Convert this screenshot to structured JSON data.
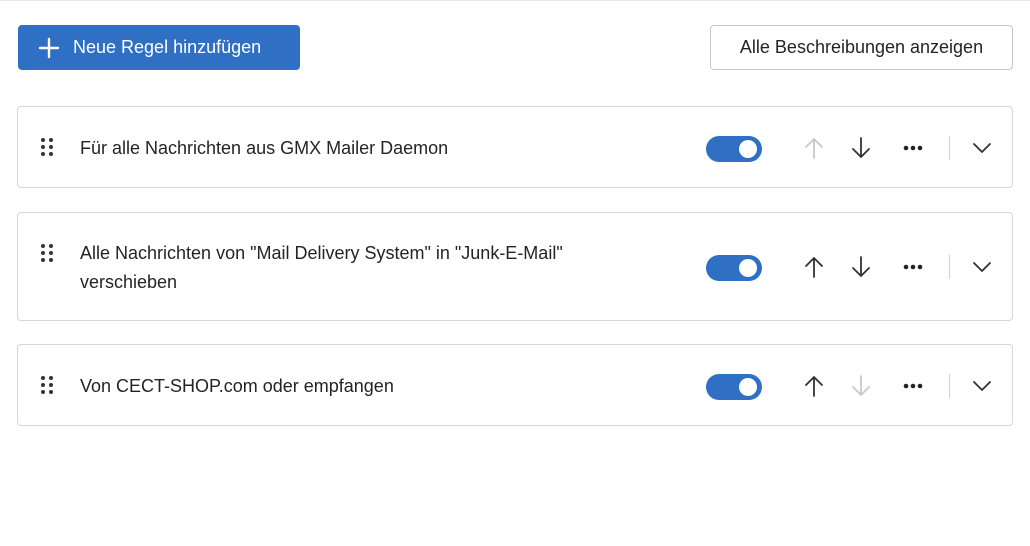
{
  "toolbar": {
    "add_rule_label": "Neue Regel hinzufügen",
    "show_descriptions_label": "Alle Beschreibungen anzeigen"
  },
  "rules": [
    {
      "label": "Für alle Nachrichten aus GMX Mailer Daemon",
      "enabled": true,
      "move_up_enabled": false,
      "move_down_enabled": true
    },
    {
      "label": "Alle Nachrichten von \"Mail Delivery System\" in \"Junk-E-Mail\" verschieben",
      "enabled": true,
      "move_up_enabled": true,
      "move_down_enabled": true
    },
    {
      "label": "Von CECT-SHOP.com oder empfangen",
      "enabled": true,
      "move_up_enabled": true,
      "move_down_enabled": false
    }
  ],
  "colors": {
    "accent": "#2f6fc4",
    "icon_active": "#333333",
    "icon_disabled": "#c8c8c8",
    "border": "#d6d6d6"
  },
  "icons": {
    "add": "plus-icon",
    "drag": "drag-handle-icon",
    "up": "arrow-up-icon",
    "down": "arrow-down-icon",
    "more": "more-options-icon",
    "expand": "chevron-down-icon"
  }
}
